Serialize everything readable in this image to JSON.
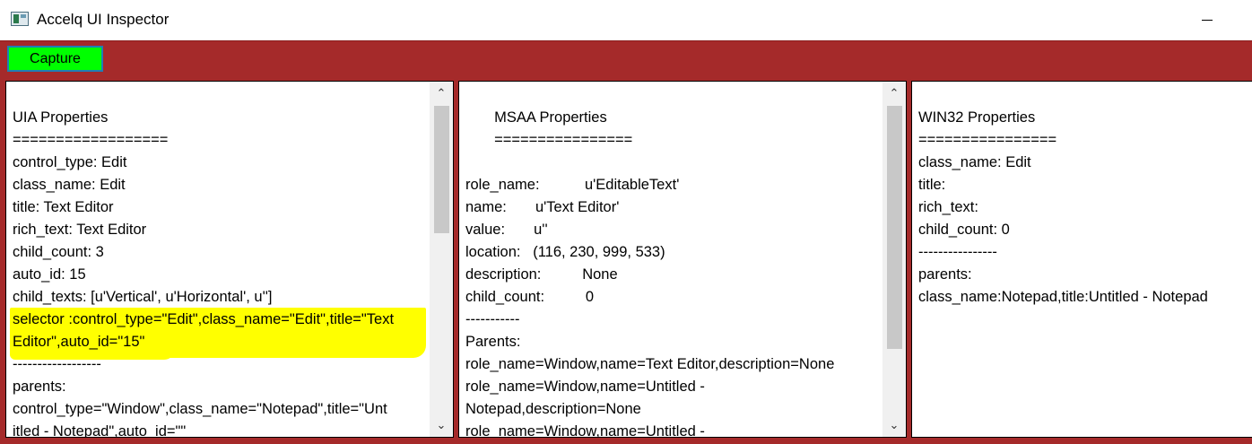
{
  "window": {
    "title": "Accelq UI Inspector"
  },
  "toolbar": {
    "capture_label": "Capture"
  },
  "uia": {
    "lines": [
      "UIA Properties",
      "==================",
      "control_type: Edit",
      "class_name: Edit",
      "title: Text Editor",
      "rich_text: Text Editor",
      "child_count: 3",
      "auto_id: 15",
      "child_texts: [u'Vertical', u'Horizontal', u'']",
      "selector :control_type=\"Edit\",class_name=\"Edit\",title=\"Text",
      "Editor\",auto_id=\"15\"",
      "------------------",
      "parents:",
      "control_type=\"Window\",class_name=\"Notepad\",title=\"Unt",
      "itled - Notepad\",auto_id=\"\""
    ]
  },
  "msaa": {
    "lines": [
      "       MSAA Properties",
      "       ================",
      "",
      "role_name:           u'EditableText'",
      "name:       u'Text Editor'",
      "value:       u''",
      "location:   (116, 230, 999, 533)",
      "description:          None",
      "child_count:          0",
      "-----------",
      "Parents:",
      "role_name=Window,name=Text Editor,description=None",
      "role_name=Window,name=Untitled -",
      "Notepad,description=None",
      "role_name=Window,name=Untitled -"
    ]
  },
  "win32": {
    "lines": [
      "WIN32 Properties",
      "================",
      "class_name: Edit",
      "title:",
      "rich_text:",
      "child_count: 0",
      "----------------",
      "parents:",
      "class_name:Notepad,title:Untitled - Notepad"
    ]
  },
  "icons": {
    "scroll_up": "chevron-up-icon",
    "scroll_down": "chevron-down-icon",
    "app": "app-icon"
  },
  "colors": {
    "background": "#a52a2a",
    "capture_button": "#00ff00",
    "highlight": "#ffff00"
  }
}
